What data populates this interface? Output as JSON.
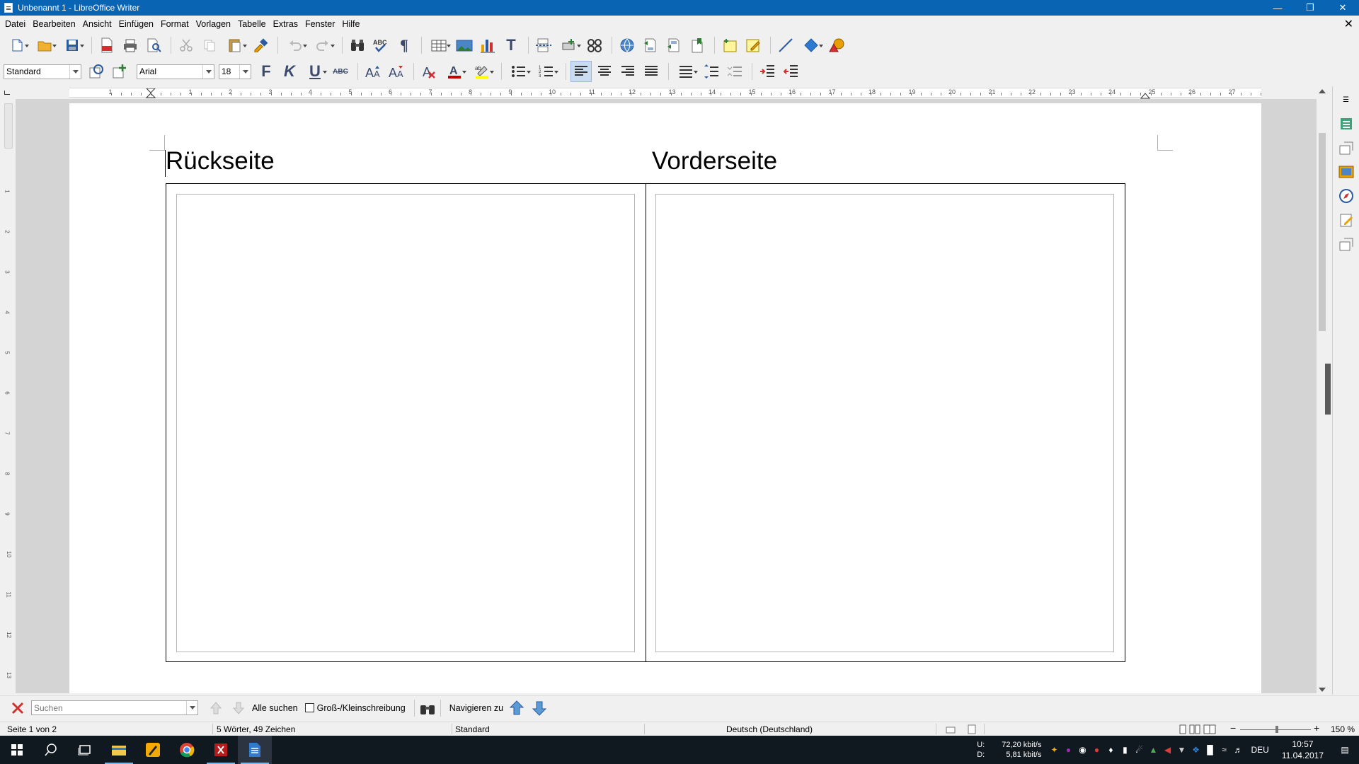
{
  "window": {
    "title": "Unbenannt 1 - LibreOffice Writer"
  },
  "menu": [
    "Datei",
    "Bearbeiten",
    "Ansicht",
    "Einfügen",
    "Format",
    "Vorlagen",
    "Tabelle",
    "Extras",
    "Fenster",
    "Hilfe"
  ],
  "formatting": {
    "style": "Standard",
    "font": "Arial",
    "size": "18",
    "bold_glyph": "F",
    "italic_glyph": "K",
    "underline_glyph": "U",
    "strike_glyph": "ABC"
  },
  "document": {
    "heading_left": "Rückseite",
    "heading_right": "Vorderseite"
  },
  "ruler": {
    "numbers": [
      "1",
      "1",
      "2",
      "3",
      "4",
      "5",
      "6",
      "7",
      "8",
      "9",
      "10",
      "11",
      "12",
      "13",
      "14",
      "15",
      "16",
      "17",
      "18",
      "19",
      "20",
      "21",
      "22",
      "23",
      "24",
      "25",
      "26",
      "27"
    ],
    "vertical_numbers": [
      "1",
      "2",
      "3",
      "4",
      "5",
      "6",
      "7",
      "8",
      "9",
      "10",
      "11",
      "12",
      "13"
    ]
  },
  "findbar": {
    "placeholder": "Suchen",
    "find_all": "Alle suchen",
    "match_case": "Groß-/Kleinschreibung",
    "navigate": "Navigieren zu"
  },
  "status": {
    "page": "Seite 1 von 2",
    "words": "5 Wörter, 49 Zeichen",
    "page_style": "Standard",
    "language": "Deutsch (Deutschland)",
    "zoom": "150 %"
  },
  "taskbar": {
    "upload_label": "U:",
    "download_label": "D:",
    "upload": "72,20 kbit/s",
    "download": "5,81 kbit/s",
    "input_lang": "DEU",
    "time": "10:57",
    "date": "11.04.2017"
  },
  "colors": {
    "titlebar": "#0a64b4",
    "font_color_bar": "#c00000",
    "highlight_bar": "#ffff00"
  }
}
